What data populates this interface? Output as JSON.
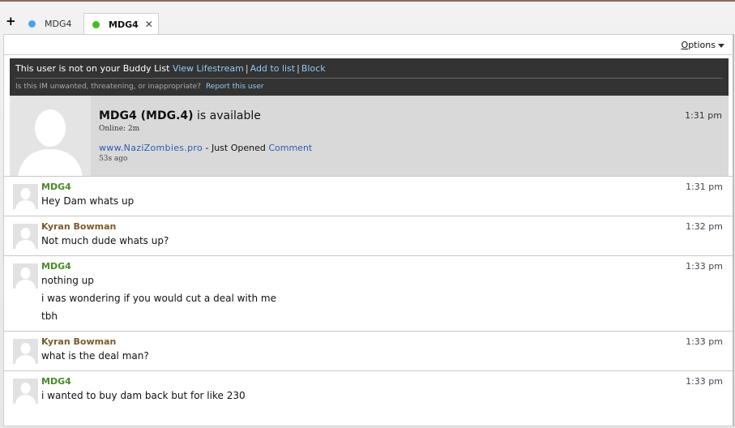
{
  "tabs": [
    {
      "label": "MDG4",
      "dot_color": "#4aa3e8"
    },
    {
      "label": "MDG4",
      "dot_color": "#44bb22",
      "close": "✕"
    }
  ],
  "add_tab": "+",
  "options": {
    "label_u": "O",
    "label_rest": "ptions"
  },
  "warning": {
    "text": "This user is not on your Buddy List",
    "link_lifestream": "View Lifestream",
    "link_add": "Add to list",
    "link_block": "Block",
    "sep": "|",
    "question": "Is this IM unwanted, threatening, or inappropriate?",
    "report": "Report this user"
  },
  "profile": {
    "name": "MDG4 (MDG.4)",
    "suffix": "is available",
    "online": "Online: 2m",
    "time": "1:31 pm",
    "status_link": "www.NaziZombies.pro",
    "status_text": "- Just Opened",
    "comment": "Comment",
    "ago": "53s ago"
  },
  "messages": [
    {
      "sender": "MDG4",
      "time": "1:31 pm",
      "lines": [
        "Hey Dam whats up"
      ]
    },
    {
      "sender": "Kyran Bowman",
      "time": "1:32 pm",
      "lines": [
        "Not much dude whats up?"
      ]
    },
    {
      "sender": "MDG4",
      "time": "1:33 pm",
      "lines": [
        "nothing up",
        "i was wondering if you would cut a deal with me",
        "tbh"
      ]
    },
    {
      "sender": "Kyran Bowman",
      "time": "1:33 pm",
      "lines": [
        "what is the deal man?"
      ]
    },
    {
      "sender": "MDG4",
      "time": "1:33 pm",
      "lines": [
        "i wanted to buy dam back but for like 230"
      ]
    }
  ]
}
